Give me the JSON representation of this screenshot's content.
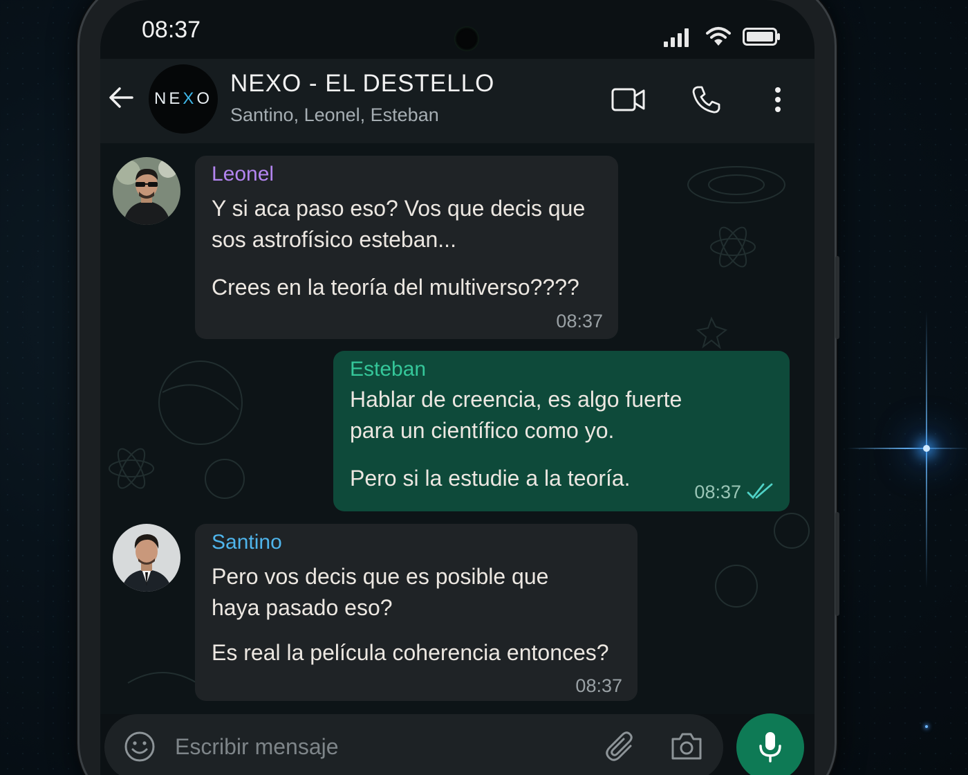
{
  "status_bar": {
    "time": "08:37"
  },
  "header": {
    "avatar_text_left": "NE",
    "avatar_text_x": "X",
    "avatar_text_right": "O",
    "title": "NEXO - EL DESTELLO",
    "members": "Santino, Leonel, Esteban"
  },
  "messages": [
    {
      "sender": "Leonel",
      "sender_color": "#b385f0",
      "direction": "incoming",
      "lines": [
        "Y si aca paso eso? Vos que decis que",
        "sos astrofísico esteban...",
        "Crees en la teoría del multiverso????"
      ],
      "time": "08:37"
    },
    {
      "sender": "Esteban",
      "sender_color": "#35c79a",
      "direction": "outgoing",
      "lines": [
        "Hablar de creencia, es algo fuerte",
        "para un científico como yo.",
        "Pero si la estudie a la teoría."
      ],
      "time": "08:37",
      "read_status": "double-check-read"
    },
    {
      "sender": "Santino",
      "sender_color": "#4fb5ec",
      "direction": "incoming",
      "lines": [
        "Pero vos decis que es posible que",
        "haya pasado eso?",
        "Es real la película coherencia entonces?"
      ],
      "time": "08:37"
    }
  ],
  "composer": {
    "placeholder": "Escribir mensaje"
  },
  "colors": {
    "accent": "#0e7a55",
    "outgoing_bubble": "#0e4a3a",
    "incoming_bubble": "#1f2326"
  },
  "icons": [
    "back-arrow-icon",
    "video-call-icon",
    "phone-icon",
    "more-vertical-icon",
    "emoji-icon",
    "attach-icon",
    "camera-icon",
    "mic-icon",
    "signal-icon",
    "wifi-icon",
    "battery-icon"
  ]
}
